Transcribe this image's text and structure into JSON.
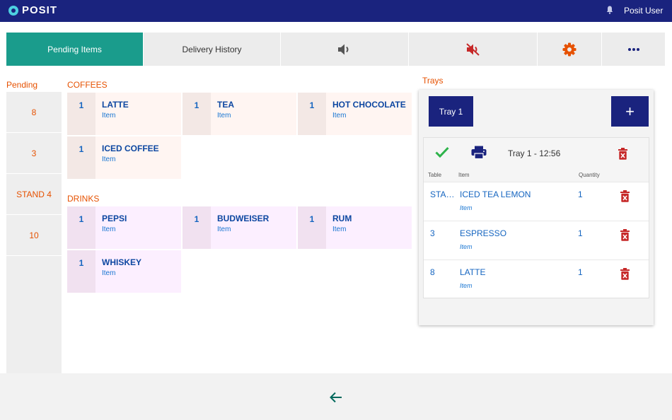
{
  "header": {
    "logo_text": "POSIT",
    "user_name": "Posit User"
  },
  "tabs": [
    {
      "label": "Pending Items",
      "active": true
    },
    {
      "label": "Delivery History",
      "active": false
    },
    {
      "icon": "volume-icon"
    },
    {
      "icon": "mute-icon"
    },
    {
      "icon": "gear-icon"
    },
    {
      "icon": "more-icon"
    }
  ],
  "pending": {
    "title": "Pending",
    "items": [
      "8",
      "3",
      "STAND 4",
      "10"
    ]
  },
  "sections": [
    {
      "title": "COFFEES",
      "items": [
        {
          "qty": "1",
          "name": "LATTE",
          "sub": "Item"
        },
        {
          "qty": "1",
          "name": "TEA",
          "sub": "Item"
        },
        {
          "qty": "1",
          "name": "HOT CHOCOLATE",
          "sub": "Item"
        },
        {
          "qty": "1",
          "name": "ICED COFFEE",
          "sub": "Item"
        }
      ]
    },
    {
      "title": "DRINKS",
      "items": [
        {
          "qty": "1",
          "name": "PEPSI",
          "sub": "Item"
        },
        {
          "qty": "1",
          "name": "BUDWEISER",
          "sub": "Item"
        },
        {
          "qty": "1",
          "name": "RUM",
          "sub": "Item"
        },
        {
          "qty": "1",
          "name": "WHISKEY",
          "sub": "Item"
        }
      ]
    }
  ],
  "trays": {
    "title": "Trays",
    "tray_button": "Tray 1",
    "add_button": "+",
    "card_label": "Tray 1 - 12:56",
    "columns": {
      "table": "Table",
      "item": "Item",
      "quantity": "Quantity"
    },
    "rows": [
      {
        "table": "STA…",
        "item": "ICED TEA LEMON",
        "sub": "Item",
        "qty": "1"
      },
      {
        "table": "3",
        "item": "ESPRESSO",
        "sub": "Item",
        "qty": "1"
      },
      {
        "table": "8",
        "item": "LATTE",
        "sub": "Item",
        "qty": "1"
      }
    ]
  },
  "colors": {
    "primary": "#1a237e",
    "active_tab": "#1a9c8c",
    "accent": "#e65100",
    "danger": "#c62828",
    "success": "#2e7d32"
  }
}
